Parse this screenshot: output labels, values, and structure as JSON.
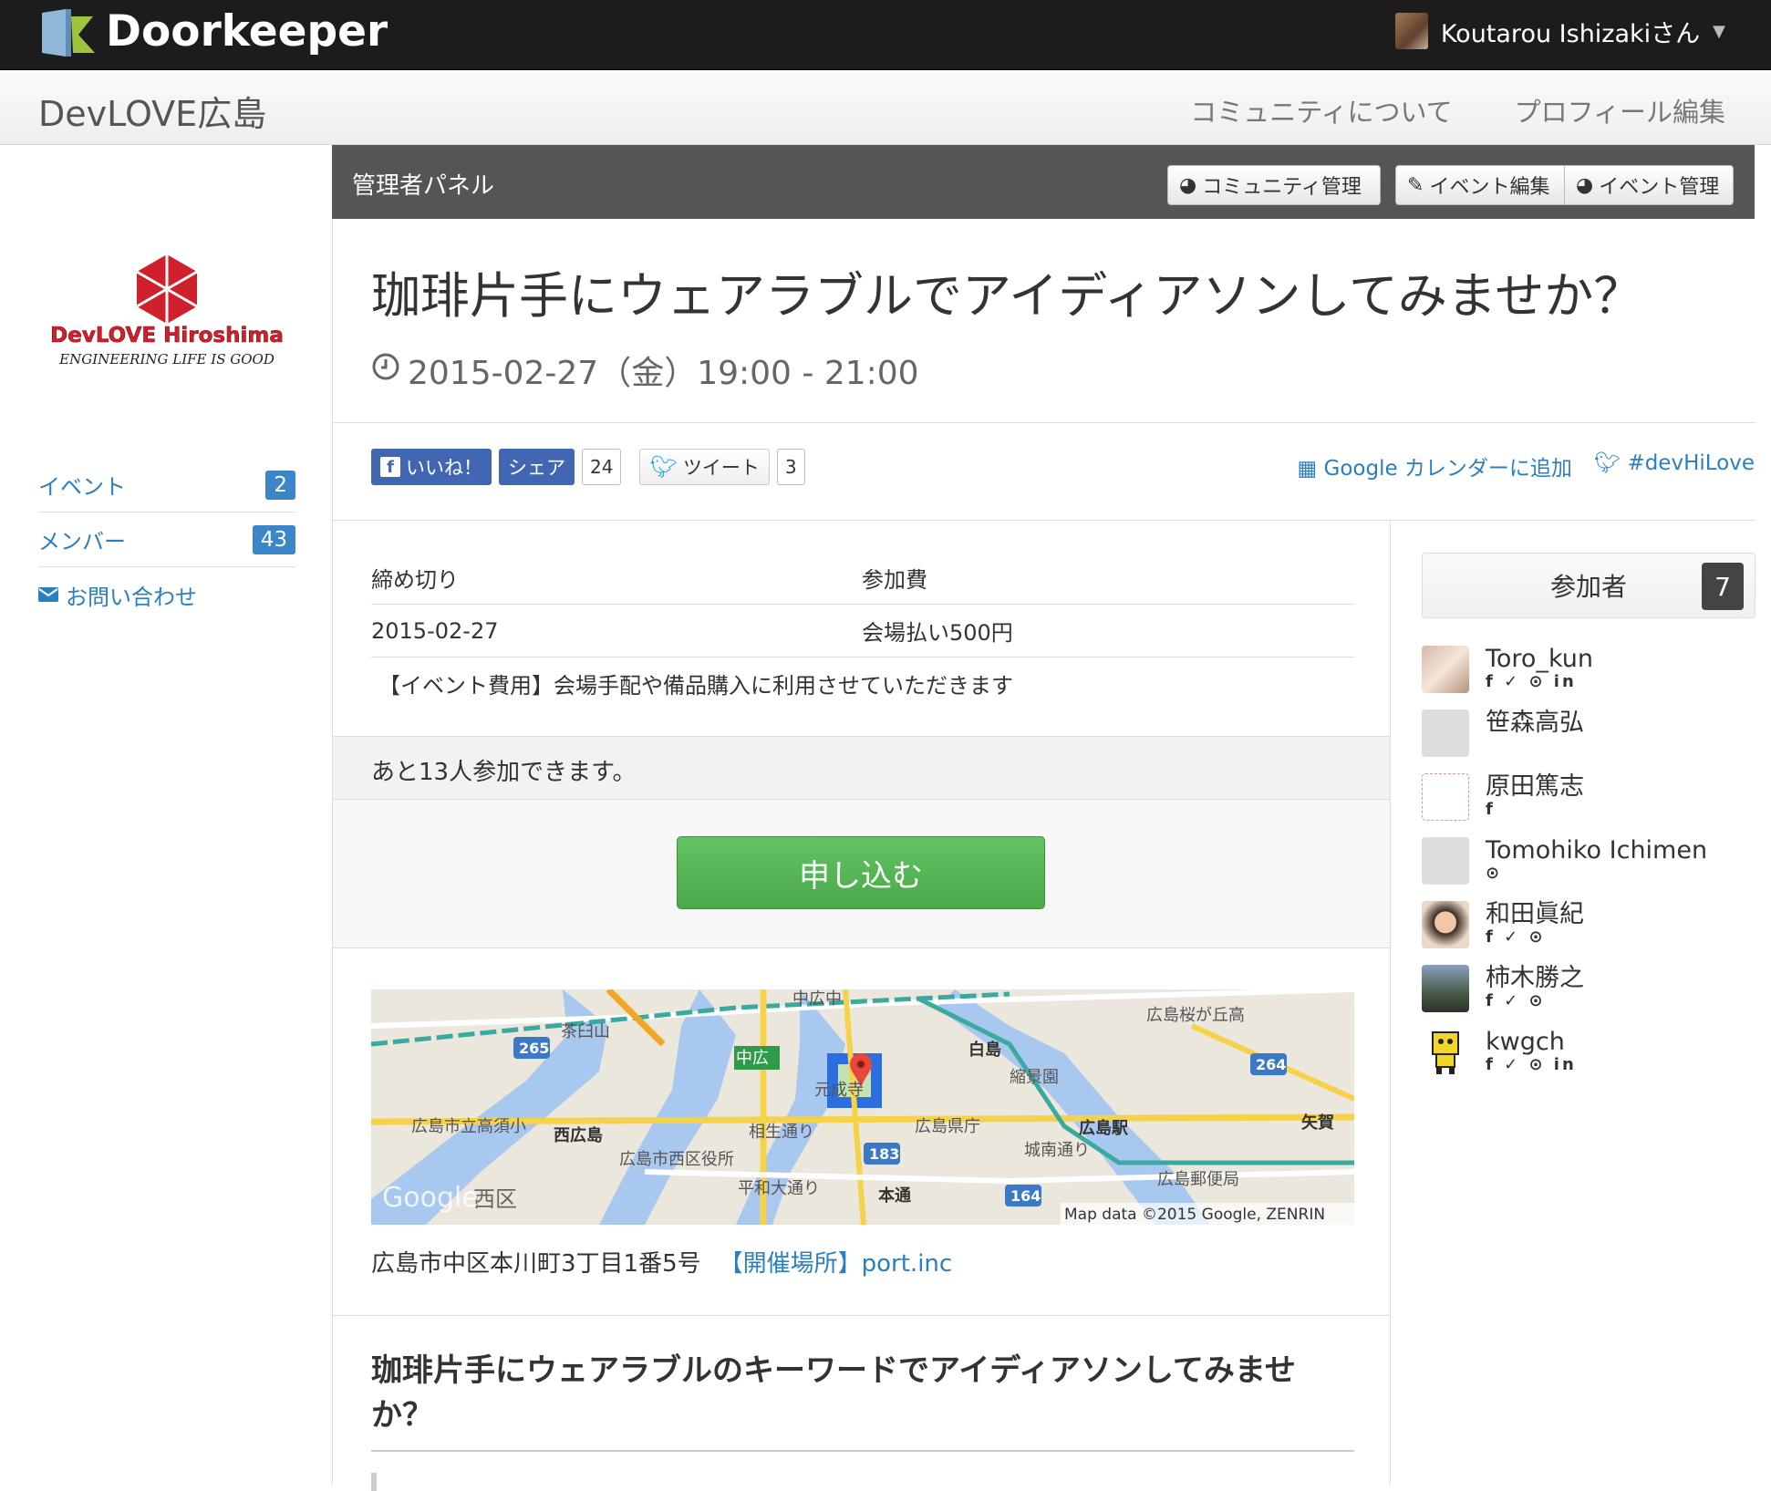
{
  "topbar": {
    "brand": "Doorkeeper",
    "user_name": "Koutarou Ishizakiさん"
  },
  "community": {
    "title": "DevLOVE広島",
    "nav": [
      "コミュニティについて",
      "プロフィール編集"
    ]
  },
  "sidebar": {
    "logo_line1": "DevLOVE Hiroshima",
    "logo_line2": "ENGINEERING LIFE IS GOOD",
    "items": [
      {
        "label": "イベント",
        "count": "2"
      },
      {
        "label": "メンバー",
        "count": "43"
      },
      {
        "label": "お問い合わせ",
        "count": ""
      }
    ]
  },
  "admin": {
    "title": "管理者パネル",
    "buttons": [
      "コミュニティ管理",
      "イベント編集",
      "イベント管理"
    ]
  },
  "event": {
    "title": "珈琲片手にウェアラブルでアイディアソンしてみませか？",
    "datetime": "2015-02-27（金）19:00 - 21:00"
  },
  "social": {
    "like": "いいね！",
    "share": "シェア",
    "share_count": "24",
    "tweet": "ツイート",
    "tweet_count": "3",
    "calendar_link": "Google カレンダーに追加",
    "hashtag_link": "#devHiLove"
  },
  "info": {
    "deadline_label": "締め切り",
    "fee_label": "参加費",
    "deadline_value": "2015-02-27",
    "fee_value": "会場払い500円",
    "note": "【イベント費用】会場手配や備品購入に利用させていただきます"
  },
  "remaining": "あと13人参加できます。",
  "apply_button": "申し込む",
  "map": {
    "labels": [
      "中広中",
      "広島桜が丘高",
      "茶臼山",
      "白島",
      "中広",
      "縮景園",
      "元成寺",
      "広島県庁",
      "矢賀",
      "広島市立高須小",
      "西広島",
      "相生通り",
      "広島市西区役所",
      "城南通り",
      "広島駅",
      "平和大通り",
      "本通",
      "広島郵便局",
      "西区",
      "Google"
    ],
    "route_numbers": [
      "265",
      "264",
      "183",
      "164"
    ],
    "attribution": "Map data ©2015 Google, ZENRIN"
  },
  "address": {
    "text": "広島市中区本川町3丁目1番5号",
    "venue_link": "【開催場所】port.inc"
  },
  "description": {
    "title": "珈琲片手にウェアラブルのキーワードでアイディアソンしてみませか？"
  },
  "participants": {
    "header": "参加者",
    "count": "7",
    "list": [
      {
        "name": "Toro_kun",
        "social": "f ✓ ⊙ in"
      },
      {
        "name": "笹森高弘",
        "social": ""
      },
      {
        "name": "原田篤志",
        "social": "f"
      },
      {
        "name": "Tomohiko Ichimen",
        "social": "⊙"
      },
      {
        "name": "和田眞紀",
        "social": "f ✓ ⊙"
      },
      {
        "name": "柿木勝之",
        "social": "f ✓ ⊙"
      },
      {
        "name": "kwgch",
        "social": "f ✓ ⊙ in"
      }
    ]
  },
  "colors": {
    "topbar": "#1c1c1c",
    "link": "#2a7fc1",
    "apply_green": "#5cb85c",
    "admin_bar": "#555555",
    "logo_red": "#d0202b"
  }
}
